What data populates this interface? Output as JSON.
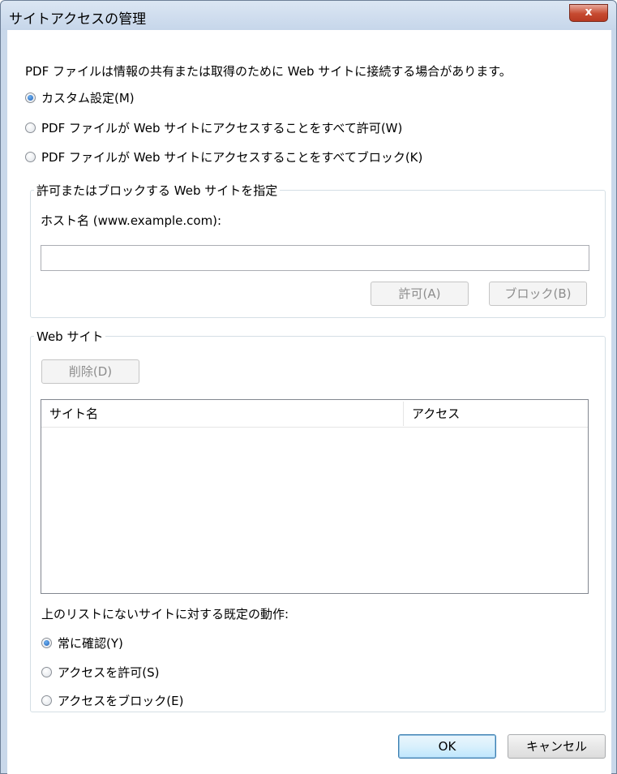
{
  "window": {
    "title": "サイトアクセスの管理",
    "close_label": "x"
  },
  "intro_text": "PDF ファイルは情報の共有または取得のために Web サイトに接続する場合があります。",
  "mode_options": [
    {
      "label": "カスタム設定(M)",
      "checked": true
    },
    {
      "label": "PDF ファイルが Web サイトにアクセスすることをすべて許可(W)",
      "checked": false
    },
    {
      "label": "PDF ファイルが Web サイトにアクセスすることをすべてブロック(K)",
      "checked": false
    }
  ],
  "specify_group": {
    "legend": "許可またはブロックする Web サイトを指定",
    "hostname_label": "ホスト名 (www.example.com):",
    "hostname_value": "",
    "allow_button": "許可(A)",
    "block_button": "ブロック(B)"
  },
  "websites_group": {
    "legend": "Web サイト",
    "delete_button": "削除(D)",
    "columns": [
      "サイト名",
      "アクセス"
    ],
    "rows": [],
    "default_behavior_label": "上のリストにないサイトに対する既定の動作:",
    "default_options": [
      {
        "label": "常に確認(Y)",
        "checked": true
      },
      {
        "label": "アクセスを許可(S)",
        "checked": false
      },
      {
        "label": "アクセスをブロック(E)",
        "checked": false
      }
    ]
  },
  "footer": {
    "ok_button": "OK",
    "cancel_button": "キャンセル"
  }
}
